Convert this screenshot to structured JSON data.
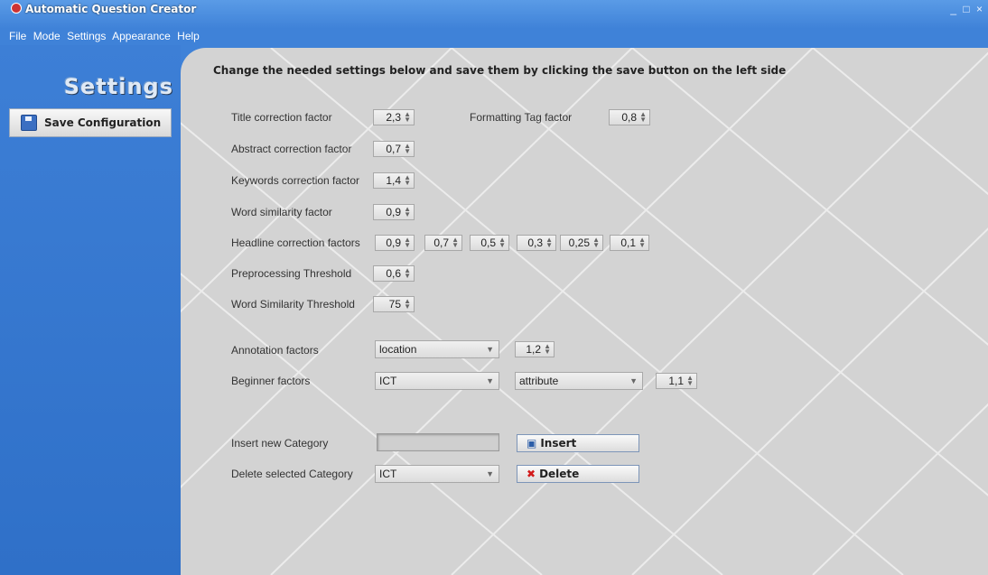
{
  "window": {
    "title": "Automatic Question Creator",
    "controls": "_ □ ×"
  },
  "menu": [
    "File",
    "Mode",
    "Settings",
    "Appearance",
    "Help"
  ],
  "sidebar": {
    "heading": "Settings",
    "save_label": "Save Configuration"
  },
  "instruction": "Change the needed settings below and save them by clicking the save button on the left side",
  "fields": {
    "title_correction": {
      "label": "Title correction factor",
      "value": "2,3"
    },
    "formatting_tag": {
      "label": "Formatting Tag factor",
      "value": "0,8"
    },
    "abstract_correction": {
      "label": "Abstract correction factor",
      "value": "0,7"
    },
    "keywords_correction": {
      "label": "Keywords correction factor",
      "value": "1,4"
    },
    "word_similarity": {
      "label": "Word similarity factor",
      "value": "0,9"
    },
    "headline_correction": {
      "label": "Headline correction factors",
      "values": [
        "0,9",
        "0,7",
        "0,5",
        "0,3",
        "0,25",
        "0,1"
      ]
    },
    "preprocessing_threshold": {
      "label": "Preprocessing Threshold",
      "value": "0,6"
    },
    "word_similarity_threshold": {
      "label": "Word Similarity Threshold",
      "value": "75"
    }
  },
  "annotation": {
    "label": "Annotation factors",
    "combo": "location",
    "value": "1,2"
  },
  "beginner": {
    "label": "Beginner factors",
    "combo1": "ICT",
    "combo2": "attribute",
    "value": "1,1"
  },
  "insert_category": {
    "label": "Insert new Category",
    "input_value": "",
    "button": "Insert"
  },
  "delete_category": {
    "label": "Delete selected Category",
    "combo": "ICT",
    "button": "Delete"
  }
}
